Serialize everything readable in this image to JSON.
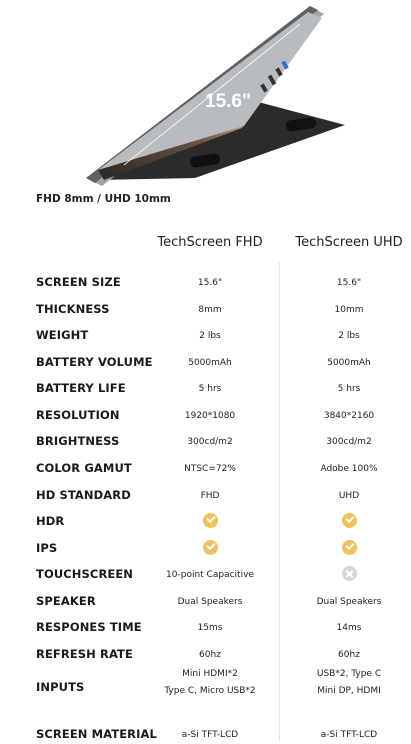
{
  "hero": {
    "screen_size_text": "15.6\""
  },
  "caption": "FHD 8mm / UHD 10mm",
  "columns": [
    "TechScreen FHD",
    "TechScreen UHD"
  ],
  "rows": [
    {
      "label": "SCREEN SIZE",
      "fhd": "15.6\"",
      "uhd": "15.6\""
    },
    {
      "label": "THICKNESS",
      "fhd": "8mm",
      "uhd": "10mm"
    },
    {
      "label": "WEIGHT",
      "fhd": "2 lbs",
      "uhd": "2 lbs"
    },
    {
      "label": "BATTERY VOLUME",
      "fhd": "5000mAh",
      "uhd": "5000mAh"
    },
    {
      "label": "BATTERY LIFE",
      "fhd": "5 hrs",
      "uhd": "5 hrs"
    },
    {
      "label": "RESOLUTION",
      "fhd": "1920*1080",
      "uhd": "3840*2160"
    },
    {
      "label": "BRIGHTNESS",
      "fhd": "300cd/m2",
      "uhd": "300cd/m2"
    },
    {
      "label": "COLOR GAMUT",
      "fhd": "NTSC=72%",
      "uhd": "Adobe 100%"
    },
    {
      "label": "HD STANDARD",
      "fhd": "FHD",
      "uhd": "UHD"
    },
    {
      "label": "HDR",
      "fhd_icon": "check-icon",
      "uhd_icon": "check-icon"
    },
    {
      "label": "IPS",
      "fhd_icon": "check-icon",
      "uhd_icon": "check-icon"
    },
    {
      "label": "TOUCHSCREEN",
      "fhd": "10-point Capacitive",
      "uhd_icon": "cross-icon"
    },
    {
      "label": "SPEAKER",
      "fhd": "Dual Speakers",
      "uhd": "Dual Speakers"
    },
    {
      "label": "RESPONES TIME",
      "fhd": "15ms",
      "uhd": "14ms"
    },
    {
      "label": "REFRESH RATE",
      "fhd": "60hz",
      "uhd": "60hz"
    },
    {
      "label": "INPUTS",
      "fhd_lines": [
        "Mini HDMI*2",
        "Type C, Micro USB*2"
      ],
      "uhd_lines": [
        "USB*2, Type C",
        "Mini DP, HDMI"
      ]
    },
    {
      "label": "SCREEN MATERIAL",
      "fhd": "a-Si TFT-LCD",
      "uhd": "a-Si TFT-LCD"
    }
  ],
  "colors": {
    "check": "#f1c25b",
    "cross": "#d6d6d6",
    "frame": "#9a9ea3",
    "stand": "#2b2b2b"
  }
}
